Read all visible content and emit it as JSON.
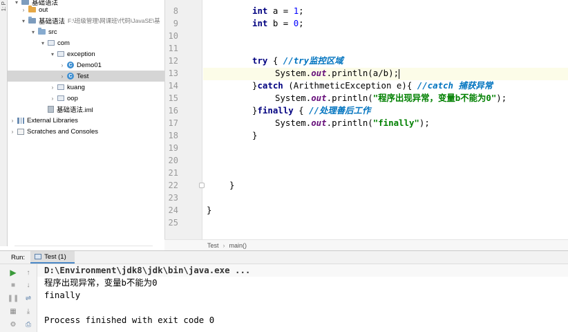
{
  "project_tree": {
    "rows": [
      {
        "label": "基础语法",
        "partial": true
      },
      {
        "label": "out"
      },
      {
        "label": "基础语法",
        "path": "F:\\班级管理\\网课班\\代码\\JavaSE\\基"
      },
      {
        "label": "src"
      },
      {
        "label": "com"
      },
      {
        "label": "exception"
      },
      {
        "label": "Demo01"
      },
      {
        "label": "Test"
      },
      {
        "label": "kuang"
      },
      {
        "label": "oop"
      },
      {
        "label": "基础语法.iml"
      },
      {
        "label": "External Libraries"
      },
      {
        "label": "Scratches and Consoles"
      }
    ]
  },
  "edge_label": "1: P",
  "editor": {
    "line_numbers": [
      "8",
      "9",
      "10",
      "11",
      "12",
      "13",
      "14",
      "15",
      "16",
      "17",
      "18",
      "19",
      "20",
      "21",
      "22",
      "23",
      "24",
      "25"
    ],
    "lines": {
      "l8_kw": "int",
      "l8_rest": " a = ",
      "l8_num": "1",
      "l8_end": ";",
      "l9_kw": "int",
      "l9_rest": " b = ",
      "l9_num": "0",
      "l9_end": ";",
      "l12_kw": "try",
      "l12_rest": " { ",
      "l12_cmt": "//try监控区域",
      "l13_a": "System.",
      "l13_fld": "out",
      "l13_b": ".println(a/b);",
      "l14_a": "}",
      "l14_kw": "catch",
      "l14_b": " (ArithmeticException e){ ",
      "l14_cmt": "//catch 捕获异常",
      "l15_a": "System.",
      "l15_fld": "out",
      "l15_b": ".println(",
      "l15_str": "\"程序出现异常，变量b不能为0\"",
      "l15_c": ");",
      "l16_a": "}",
      "l16_kw": "finally",
      "l16_b": " { ",
      "l16_cmt": "//处理善后工作",
      "l17_a": "System.",
      "l17_fld": "out",
      "l17_b": ".println(",
      "l17_str": "\"finally\"",
      "l17_c": ");",
      "l18": "}",
      "l22": "}",
      "l24": "}"
    }
  },
  "breadcrumb": {
    "items": [
      "Test",
      "main()"
    ]
  },
  "run_panel": {
    "label": "Run:",
    "tab": "Test (1)",
    "console": [
      "D:\\Environment\\jdk8\\jdk\\bin\\java.exe ...",
      "程序出现异常，变量b不能为0",
      "finally",
      "",
      "Process finished with exit code 0"
    ]
  },
  "colors": {
    "keyword": "#000080",
    "string": "#008000",
    "number": "#0000ff",
    "comment": "#808080",
    "field": "#660e7a",
    "selection": "#d5d5d5"
  }
}
